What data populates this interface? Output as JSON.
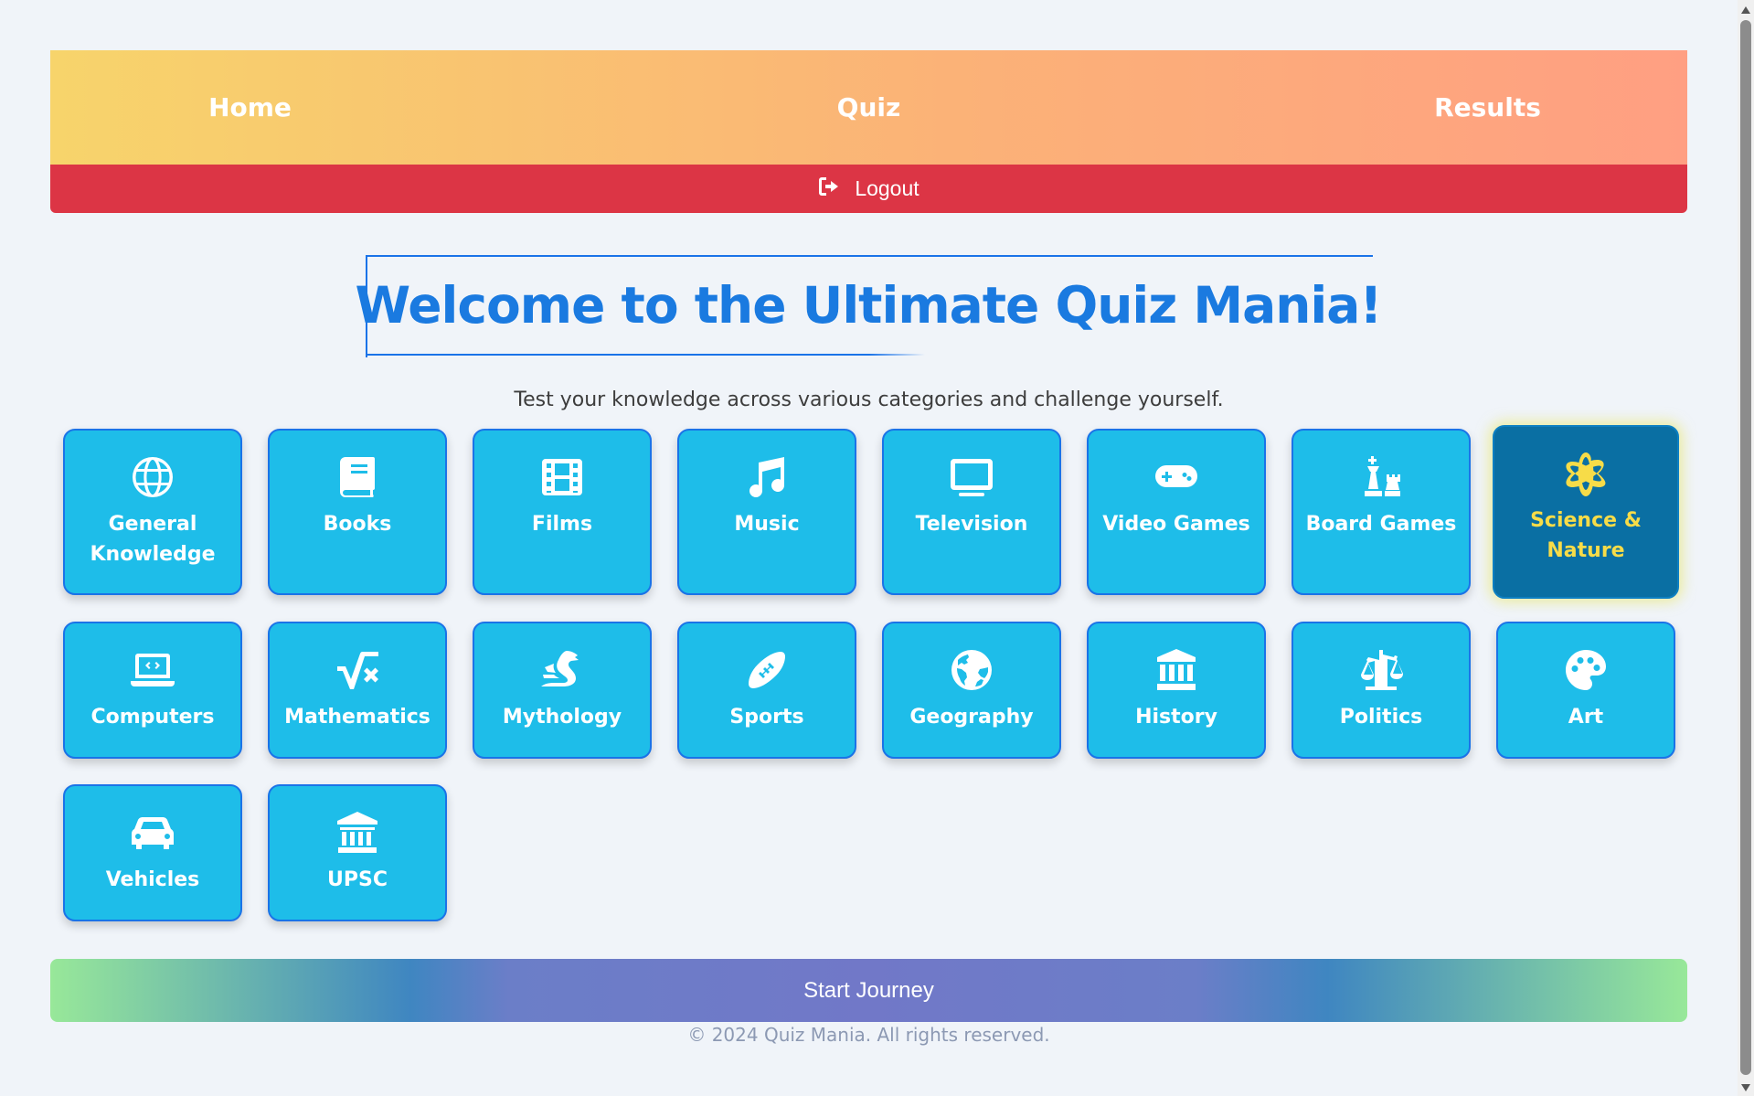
{
  "nav": {
    "home": "Home",
    "quiz": "Quiz",
    "results": "Results"
  },
  "logout": {
    "label": "Logout",
    "icon": "logout-icon"
  },
  "welcome": {
    "title": "Welcome to the Ultimate Quiz Mania!",
    "subtitle": "Test your knowledge across various categories and challenge yourself."
  },
  "categories": [
    {
      "label": "General Knowledge",
      "icon": "globe-icon"
    },
    {
      "label": "Books",
      "icon": "book-icon"
    },
    {
      "label": "Films",
      "icon": "film-icon"
    },
    {
      "label": "Music",
      "icon": "music-icon"
    },
    {
      "label": "Television",
      "icon": "tv-icon"
    },
    {
      "label": "Video Games",
      "icon": "gamepad-icon"
    },
    {
      "label": "Board Games",
      "icon": "chess-icon"
    },
    {
      "label": "Science & Nature",
      "icon": "atom-icon",
      "selected": true
    },
    {
      "label": "Computers",
      "icon": "laptop-code-icon"
    },
    {
      "label": "Mathematics",
      "icon": "square-root-icon"
    },
    {
      "label": "Mythology",
      "icon": "dragon-icon"
    },
    {
      "label": "Sports",
      "icon": "football-icon"
    },
    {
      "label": "Geography",
      "icon": "earth-icon"
    },
    {
      "label": "History",
      "icon": "landmark-icon"
    },
    {
      "label": "Politics",
      "icon": "scale-icon"
    },
    {
      "label": "Art",
      "icon": "palette-icon"
    },
    {
      "label": "Vehicles",
      "icon": "car-icon"
    },
    {
      "label": "UPSC",
      "icon": "building-columns-icon"
    }
  ],
  "start_button": "Start Journey",
  "footer": "© 2024 Quiz Mania. All rights reserved.",
  "colors": {
    "card": "#1ebde9",
    "card_selected": "#0a6fa3",
    "selected_text": "#f7dc48",
    "logout": "#dc3545",
    "title": "#1a7ae0"
  }
}
